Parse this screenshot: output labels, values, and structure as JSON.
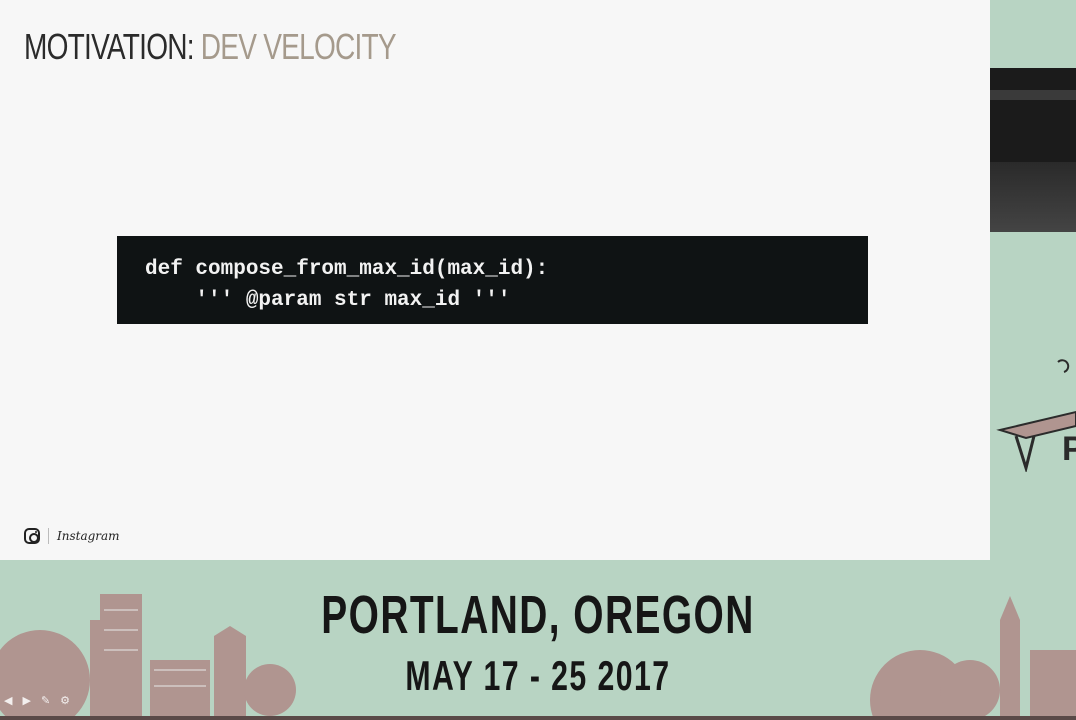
{
  "slide": {
    "title_prefix": "MOTIVATION:",
    "title_suffix": " DEV VELOCITY",
    "code_lines": [
      "def compose_from_max_id(max_id):",
      "    ''' @param str max_id '''"
    ],
    "brand": {
      "icon": "instagram-icon",
      "wordmark": "Instagram"
    }
  },
  "banner": {
    "city": "PORTLAND, OREGON",
    "dates": "MAY 17 - 25 2017"
  },
  "side_panel": {
    "letter": "P"
  },
  "player": {
    "controls": [
      "previous-icon",
      "next-icon",
      "pen-icon",
      "settings-icon"
    ]
  },
  "colors": {
    "banner_bg": "#b8d4c3",
    "slide_bg": "#f7f7f7",
    "code_bg": "#0f1314",
    "title_accent": "#a59a8c",
    "skyline": "#b09590"
  }
}
